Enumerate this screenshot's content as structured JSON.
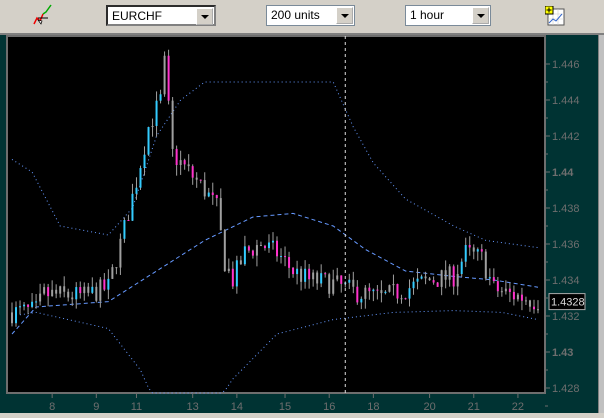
{
  "toolbar": {
    "draw_tool_icon": "chart-pencil-icon",
    "symbol": "EURCHF",
    "units": "200 units",
    "timeframe": "1 hour",
    "add_indicator_icon": "add-chart-icon"
  },
  "colors": {
    "background": "#003333",
    "plot": "#000000",
    "up": "#33ccff",
    "down": "#ff33cc",
    "neutral": "#a0a0a0",
    "band": "#6699ff",
    "axis": "#6e6e6e"
  },
  "chart_data": {
    "type": "candlestick",
    "symbol": "EURCHF",
    "ylim": [
      1.4265,
      1.4475
    ],
    "y_ticks": [
      "1.446",
      "1.444",
      "1.442",
      "1.44",
      "1.438",
      "1.436",
      "1.434",
      "1.432",
      "1.43",
      "1.428"
    ],
    "y_tick_values": [
      1.446,
      1.444,
      1.442,
      1.44,
      1.438,
      1.436,
      1.434,
      1.432,
      1.43,
      1.428
    ],
    "x_ticks": [
      "8",
      "9",
      "11",
      "13",
      "14",
      "15",
      "16",
      "18",
      "20",
      "21",
      "22"
    ],
    "x_tick_candle_index": [
      10,
      21,
      31,
      45,
      56,
      68,
      79,
      90,
      104,
      115,
      126
    ],
    "candle_count": 132,
    "close_anchors": [
      [
        0,
        1.4322
      ],
      [
        6,
        1.4323
      ],
      [
        8,
        1.4332
      ],
      [
        18,
        1.4331
      ],
      [
        24,
        1.4336
      ],
      [
        27,
        1.436
      ],
      [
        31,
        1.4395
      ],
      [
        34,
        1.4425
      ],
      [
        37,
        1.444
      ],
      [
        38,
        1.446
      ],
      [
        40,
        1.441
      ],
      [
        44,
        1.44
      ],
      [
        48,
        1.439
      ],
      [
        51,
        1.438
      ],
      [
        53,
        1.435
      ],
      [
        55,
        1.434
      ],
      [
        58,
        1.4355
      ],
      [
        62,
        1.436
      ],
      [
        66,
        1.4355
      ],
      [
        70,
        1.4345
      ],
      [
        74,
        1.434
      ],
      [
        80,
        1.4338
      ],
      [
        86,
        1.4333
      ],
      [
        92,
        1.433
      ],
      [
        98,
        1.4335
      ],
      [
        104,
        1.434
      ],
      [
        110,
        1.4342
      ],
      [
        113,
        1.4355
      ],
      [
        117,
        1.4352
      ],
      [
        120,
        1.4335
      ],
      [
        124,
        1.4332
      ],
      [
        128,
        1.433
      ],
      [
        131,
        1.4328
      ]
    ],
    "bollinger": {
      "upper": [
        [
          0,
          1.4407
        ],
        [
          5,
          1.44
        ],
        [
          12,
          1.437
        ],
        [
          24,
          1.4365
        ],
        [
          30,
          1.438
        ],
        [
          36,
          1.442
        ],
        [
          42,
          1.444
        ],
        [
          48,
          1.445
        ],
        [
          60,
          1.445
        ],
        [
          80,
          1.445
        ],
        [
          85,
          1.4425
        ],
        [
          90,
          1.4405
        ],
        [
          98,
          1.4385
        ],
        [
          110,
          1.437
        ],
        [
          118,
          1.4362
        ],
        [
          131,
          1.4358
        ]
      ],
      "middle": [
        [
          0,
          1.431
        ],
        [
          6,
          1.4325
        ],
        [
          24,
          1.4328
        ],
        [
          36,
          1.4345
        ],
        [
          48,
          1.4362
        ],
        [
          60,
          1.4375
        ],
        [
          70,
          1.4377
        ],
        [
          80,
          1.437
        ],
        [
          88,
          1.4357
        ],
        [
          98,
          1.4345
        ],
        [
          110,
          1.4342
        ],
        [
          120,
          1.434
        ],
        [
          131,
          1.4336
        ]
      ],
      "lower": [
        [
          0,
          1.432
        ],
        [
          6,
          1.4322
        ],
        [
          24,
          1.4313
        ],
        [
          32,
          1.429
        ],
        [
          38,
          1.426
        ],
        [
          48,
          1.4262
        ],
        [
          55,
          1.4285
        ],
        [
          66,
          1.431
        ],
        [
          80,
          1.4318
        ],
        [
          95,
          1.4322
        ],
        [
          110,
          1.4323
        ],
        [
          122,
          1.4322
        ],
        [
          131,
          1.4318
        ]
      ]
    },
    "marker_candle_index": 83,
    "last_price": "1.4328",
    "last_price_value": 1.4328
  }
}
